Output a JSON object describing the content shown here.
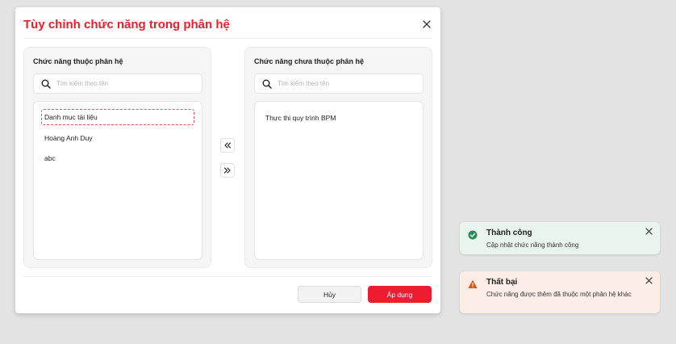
{
  "modal": {
    "title": "Tùy chỉnh chức năng trong phân hệ",
    "left_panel": {
      "title": "Chức năng thuộc phân hệ",
      "search_placeholder": "Tìm kiếm theo tên",
      "items": [
        "Danh mục tài liệu",
        "Hoàng Anh Duy",
        "abc"
      ],
      "selected_index": 0
    },
    "right_panel": {
      "title": "Chức năng chưa thuộc phân hệ",
      "search_placeholder": "Tìm kiếm theo tên",
      "items": [
        "Thực thi quy trình BPM"
      ]
    },
    "move_left_icon": "double-chevron-left-icon",
    "move_right_icon": "double-chevron-right-icon",
    "cancel_label": "Hủy",
    "apply_label": "Áp dụng",
    "accent_color": "#ee1c31"
  },
  "toasts": {
    "success": {
      "title": "Thành công",
      "message": "Cập nhật chức năng thành công",
      "color": "#2e8b57"
    },
    "error": {
      "title": "Thất bại",
      "message": "Chức năng được thêm đã thuộc một phân hệ khác",
      "color": "#d9531e"
    }
  }
}
